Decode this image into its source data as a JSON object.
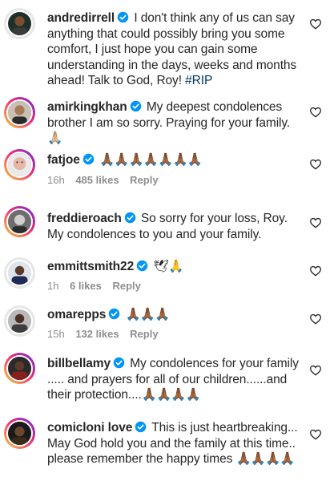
{
  "colors": {
    "username": "#262626",
    "text": "#262626",
    "meta": "#8e8e8e",
    "verified": "#0095f6",
    "hashtag": "#00376b"
  },
  "comments": [
    {
      "username": "andredirrell",
      "verified": true,
      "text": "I don't think any of us can say anything that could possibly bring you some comfort, I just hope you can gain some understanding in the days, weeks and months ahead! Talk to God, Roy!",
      "hashtag": "#RIP",
      "avatar_icon": "profile-photo"
    },
    {
      "username": "amirkingkhan",
      "verified": true,
      "text": "My deepest condolences brother I am so sorry. Praying for your family.",
      "emoji": "🙏🏼",
      "avatar_icon": "profile-photo"
    },
    {
      "username": "fatjoe",
      "verified": true,
      "emoji": "🙏🏾🙏🏾🙏🏾🙏🏾🙏🏾🙏🏾🙏🏾",
      "time": "16h",
      "likes": "485 likes",
      "reply": "Reply",
      "avatar_icon": "profile-photo"
    },
    {
      "username": "freddieroach",
      "verified": true,
      "text": "So sorry for your loss, Roy. My condolences to you and your family.",
      "avatar_icon": "profile-photo"
    },
    {
      "username": "emmittsmith22",
      "verified": true,
      "emoji": "🕊🙏",
      "time": "1h",
      "likes": "6 likes",
      "reply": "Reply",
      "avatar_icon": "profile-photo"
    },
    {
      "username": "omarepps",
      "verified": true,
      "emoji": "🙏🏾🙏🏾🙏🏾",
      "time": "15h",
      "likes": "132 likes",
      "reply": "Reply",
      "avatar_icon": "profile-photo"
    },
    {
      "username": "billbellamy",
      "verified": true,
      "text": "My condolences for your family ..... and prayers for all of our children......and their protection....",
      "emoji": "🙏🏾🙏🏾🙏🏾🙏🏾",
      "avatar_icon": "profile-photo"
    },
    {
      "username": "comicloni love",
      "verified": true,
      "text": "This is just heartbreaking... May God hold you and the family at this time.. please remember the happy times",
      "emoji": "🙏🏾🙏🏾🙏🏾🙏🏾",
      "avatar_icon": "profile-photo"
    }
  ]
}
